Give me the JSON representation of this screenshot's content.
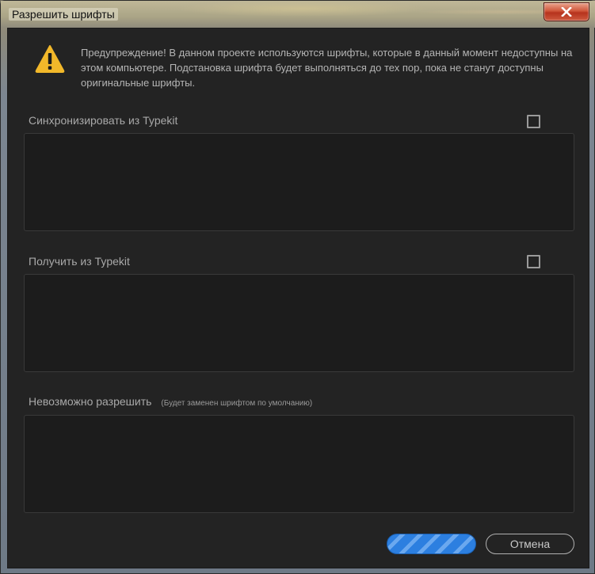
{
  "window": {
    "title": "Разрешить шрифты"
  },
  "icons": {
    "close": "close-icon",
    "warning": "warning-icon"
  },
  "warning": {
    "text": "Предупреждение! В данном проекте используются шрифты, которые в данный момент недоступны на этом компьютере. Подстановка шрифта будет выполняться до тех пор, пока не станут доступны оригинальные шрифты."
  },
  "sections": {
    "sync": {
      "label": "Синхронизировать из Typekit",
      "checked": false
    },
    "get": {
      "label": "Получить из Typekit",
      "checked": false
    },
    "unresolved": {
      "label": "Невозможно разрешить",
      "note": "(Будет заменен шрифтом по умолчанию)"
    }
  },
  "buttons": {
    "cancel": "Отмена"
  },
  "colors": {
    "dialog_bg": "#232323",
    "panel_bg": "#1c1c1c",
    "accent": "#2c7fe0",
    "warning": "#f2b82a"
  }
}
